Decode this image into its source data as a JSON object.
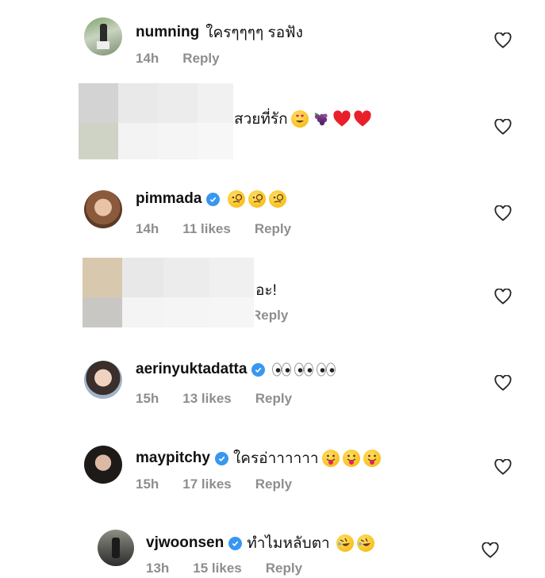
{
  "comments": [
    {
      "username": "numning",
      "text": "ใครๆๆๆๆ รอฟัง",
      "time": "14h",
      "likes": "",
      "reply": "Reply",
      "verified": false
    },
    {
      "username": "",
      "text": "สวยที่รัก",
      "time": "",
      "likes": "",
      "reply": "",
      "verified": false
    },
    {
      "username": "pimmada",
      "text": "",
      "time": "14h",
      "likes": "11 likes",
      "reply": "Reply",
      "verified": true
    },
    {
      "username": "",
      "text": "อะ!",
      "time": "",
      "likes": "",
      "reply": "Reply",
      "verified": false
    },
    {
      "username": "aerinyuktadatta",
      "text": "",
      "time": "15h",
      "likes": "13 likes",
      "reply": "Reply",
      "verified": true
    },
    {
      "username": "maypitchy",
      "text": "ใครอ่าาาาาา",
      "time": "15h",
      "likes": "17 likes",
      "reply": "Reply",
      "verified": true
    },
    {
      "username": "vjwoonsen",
      "text": "ทำไมหลับตา",
      "time": "13h",
      "likes": "15 likes",
      "reply": "Reply",
      "verified": true
    }
  ],
  "colors": {
    "verified": "#3897f0",
    "meta": "#8e8e8e",
    "heart_outline": "#262626"
  },
  "icons": [
    "heart-outline-icon",
    "verified-badge-icon"
  ]
}
